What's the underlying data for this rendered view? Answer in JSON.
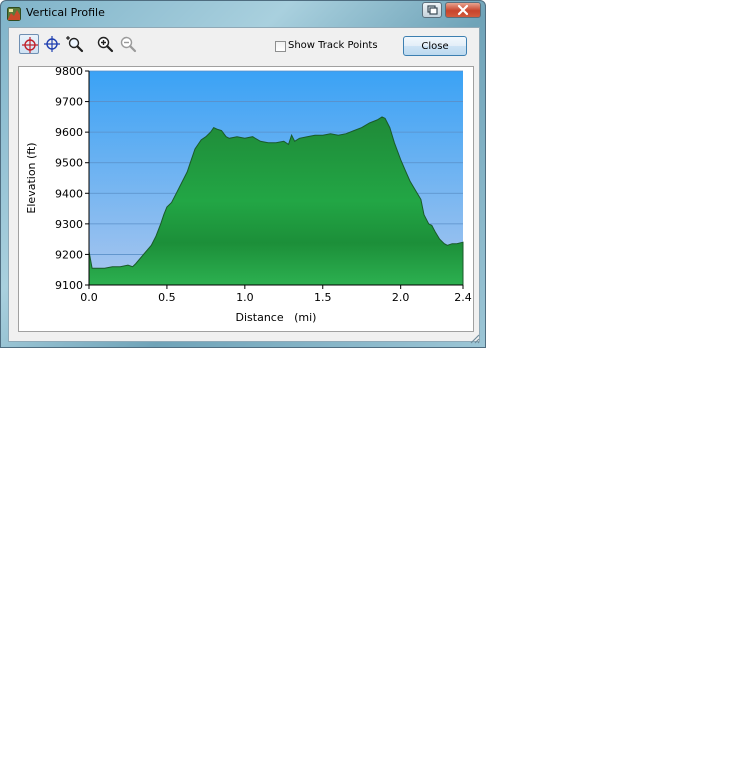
{
  "window": {
    "title": "Vertical Profile",
    "icons": {
      "app": "profile-app-icon",
      "restore": "restore-icon",
      "close": "close-x-icon"
    },
    "accent": "#3c7fb1"
  },
  "toolbar": {
    "tools": [
      "select-crosshair-icon",
      "crosshair-icon",
      "zoom-area-icon",
      "zoom-in-icon",
      "zoom-out-icon"
    ],
    "active_tool": "select-crosshair-icon",
    "show_track_points_label": "Show Track Points",
    "show_track_points_checked": false,
    "close_label": "Close"
  },
  "chart_data": {
    "type": "area",
    "xlabel": "Distance   (mi)",
    "ylabel": "Elevation (ft)",
    "xlim": [
      0,
      2.4
    ],
    "ylim": [
      9100,
      9800
    ],
    "xticks": [
      "0.0",
      "0.5",
      "1.0",
      "1.5",
      "2.0",
      "2.4"
    ],
    "yticks": [
      "9100",
      "9200",
      "9300",
      "9400",
      "9500",
      "9600",
      "9700",
      "9800"
    ],
    "grid": true,
    "fill_color": "#1f9a3c",
    "background_top": "#3aa2f5",
    "background_bottom": "#a9c6ee",
    "series": [
      {
        "x": [
          0,
          0.02,
          0.05,
          0.1,
          0.15,
          0.2,
          0.25,
          0.28,
          0.3,
          0.35,
          0.4,
          0.43,
          0.46,
          0.48,
          0.5,
          0.53,
          0.56,
          0.6,
          0.63,
          0.65,
          0.68,
          0.7,
          0.72,
          0.75,
          0.78,
          0.8,
          0.82,
          0.85,
          0.88,
          0.9,
          0.95,
          1.0,
          1.05,
          1.1,
          1.15,
          1.2,
          1.25,
          1.28,
          1.3,
          1.32,
          1.35,
          1.4,
          1.45,
          1.5,
          1.55,
          1.6,
          1.65,
          1.7,
          1.75,
          1.8,
          1.85,
          1.88,
          1.9,
          1.93,
          1.96,
          2.0,
          2.03,
          2.06,
          2.1,
          2.13,
          2.15,
          2.18,
          2.2,
          2.22,
          2.25,
          2.28,
          2.3,
          2.33,
          2.36,
          2.4
        ],
        "values": [
          9210,
          9155,
          9155,
          9155,
          9160,
          9160,
          9165,
          9160,
          9170,
          9200,
          9230,
          9260,
          9300,
          9330,
          9355,
          9370,
          9400,
          9440,
          9470,
          9500,
          9545,
          9560,
          9575,
          9585,
          9600,
          9615,
          9610,
          9605,
          9585,
          9580,
          9585,
          9580,
          9585,
          9570,
          9565,
          9565,
          9570,
          9560,
          9590,
          9570,
          9580,
          9585,
          9590,
          9590,
          9595,
          9590,
          9595,
          9605,
          9615,
          9630,
          9640,
          9650,
          9645,
          9615,
          9565,
          9510,
          9475,
          9440,
          9405,
          9380,
          9330,
          9300,
          9295,
          9275,
          9250,
          9235,
          9230,
          9235,
          9235,
          9240
        ]
      }
    ]
  }
}
